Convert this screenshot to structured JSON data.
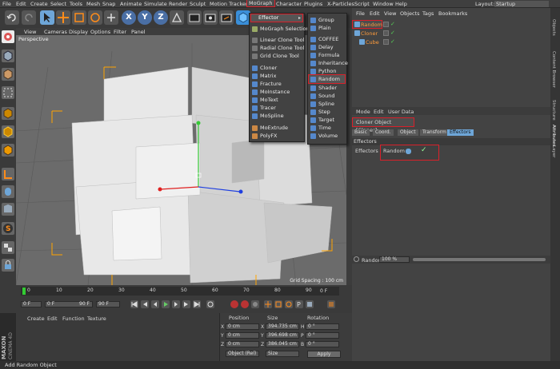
{
  "menubar": {
    "items": [
      "File",
      "Edit",
      "Create",
      "Select",
      "Tools",
      "Mesh",
      "Snap",
      "Animate",
      "Simulate",
      "Render",
      "Sculpt",
      "Motion Tracker",
      "MoGraph",
      "Character",
      "Plugins",
      "X-Particles",
      "Script",
      "Window",
      "Help"
    ],
    "layout_label": "Layout:",
    "layout_value": "Startup"
  },
  "toolbar": {
    "axis_x": "X",
    "axis_y": "Y",
    "axis_z": "Z"
  },
  "viewport": {
    "menu": [
      "View",
      "Cameras",
      "Display",
      "Options",
      "Filter",
      "Panel"
    ],
    "name": "Perspective",
    "grid_spacing": "Grid Spacing : 100 cm"
  },
  "mograph_menu": {
    "header": "Effector",
    "items": [
      "MoGraph Selection",
      "Linear Clone Tool",
      "Radial Clone Tool",
      "Grid Clone Tool",
      "Cloner",
      "Matrix",
      "Fracture",
      "MoInstance",
      "MoText",
      "Tracer",
      "MoSpline",
      "MoExtrude",
      "PolyFX"
    ]
  },
  "effector_menu": {
    "items": [
      "Group",
      "Plain",
      "COFFEE",
      "Delay",
      "Formula",
      "Inheritance",
      "Python",
      "Random",
      "Shader",
      "Sound",
      "Spline",
      "Step",
      "Target",
      "Time",
      "Volume"
    ],
    "selected": "Random"
  },
  "object_manager": {
    "menu": [
      "File",
      "Edit",
      "View",
      "Objects",
      "Tags",
      "Bookmarks"
    ],
    "objects": [
      "Random",
      "Cloner",
      "Cube"
    ]
  },
  "attributes": {
    "menu": [
      "Mode",
      "Edit",
      "User Data"
    ],
    "title": "Cloner Object [Cloner]",
    "tabs": [
      "Basic",
      "Coord.",
      "Object",
      "Transform",
      "Effectors"
    ],
    "active_tab": "Effectors",
    "section": "Effectors",
    "field_label": "Effectors",
    "effector_item": "Random",
    "strength_label": "Random",
    "strength_value": "100 %"
  },
  "timeline": {
    "ticks": [
      "0",
      "10",
      "20",
      "30",
      "40",
      "50",
      "60",
      "70",
      "80",
      "90"
    ],
    "current": "0 F",
    "start": "0 F",
    "end": "90 F",
    "range_a": "0 F",
    "range_b": "90 F"
  },
  "materials": {
    "menu": [
      "Create",
      "Edit",
      "Function",
      "Texture"
    ],
    "brand": "MAXON",
    "product": "CINEMA 4D"
  },
  "coords": {
    "headers": [
      "Position",
      "Size",
      "Rotation"
    ],
    "rows": [
      {
        "axis": "X",
        "pos": "0 cm",
        "size": "394.735 cm",
        "rot_axis": "H",
        "rot": "0 °"
      },
      {
        "axis": "Y",
        "pos": "0 cm",
        "size": "396.698 cm",
        "rot_axis": "P",
        "rot": "0 °"
      },
      {
        "axis": "Z",
        "pos": "0 cm",
        "size": "386.045 cm",
        "rot_axis": "B",
        "rot": "0 °"
      }
    ],
    "mode": "Object (Rel)",
    "size_mode": "Size",
    "apply": "Apply"
  },
  "status": "Add Random Object",
  "sidetabs": [
    "Objects",
    "Content Browser",
    "Structure",
    "Attributes",
    "Layer"
  ],
  "colors": {
    "highlight": "#d9202a",
    "accent": "#ff8c1a",
    "selection": "#6ea6d8"
  }
}
